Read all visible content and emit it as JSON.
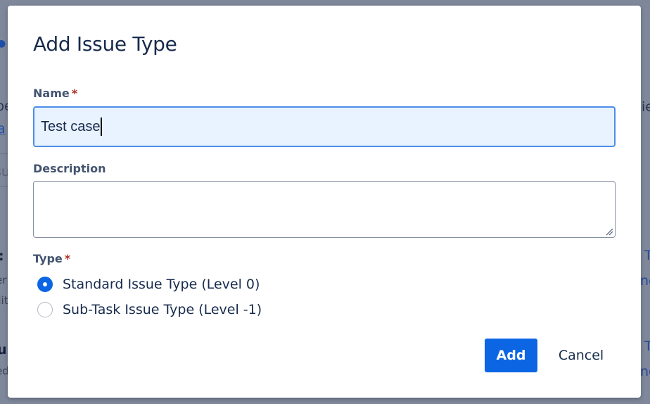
{
  "background": {
    "left_fragments": [
      "pe",
      "a",
      "su",
      ":",
      "er",
      "dit",
      "u",
      "ed"
    ],
    "right_fragments": [
      "ie",
      "T",
      "ne",
      "T",
      "ne"
    ]
  },
  "dialog": {
    "title": "Add Issue Type",
    "name_field": {
      "label": "Name",
      "required_marker": "*",
      "value": "Test case"
    },
    "description_field": {
      "label": "Description",
      "value": ""
    },
    "type_field": {
      "label": "Type",
      "required_marker": "*",
      "options": [
        {
          "label": "Standard Issue Type (Level 0)",
          "checked": true
        },
        {
          "label": "Sub-Task Issue Type (Level -1)",
          "checked": false
        }
      ]
    },
    "buttons": {
      "add": "Add",
      "cancel": "Cancel"
    }
  },
  "colors": {
    "primary": "#0c66e4",
    "required": "#ae2e24",
    "input_focus_bg": "#e9f2ff",
    "overlay": "#7f889a"
  }
}
